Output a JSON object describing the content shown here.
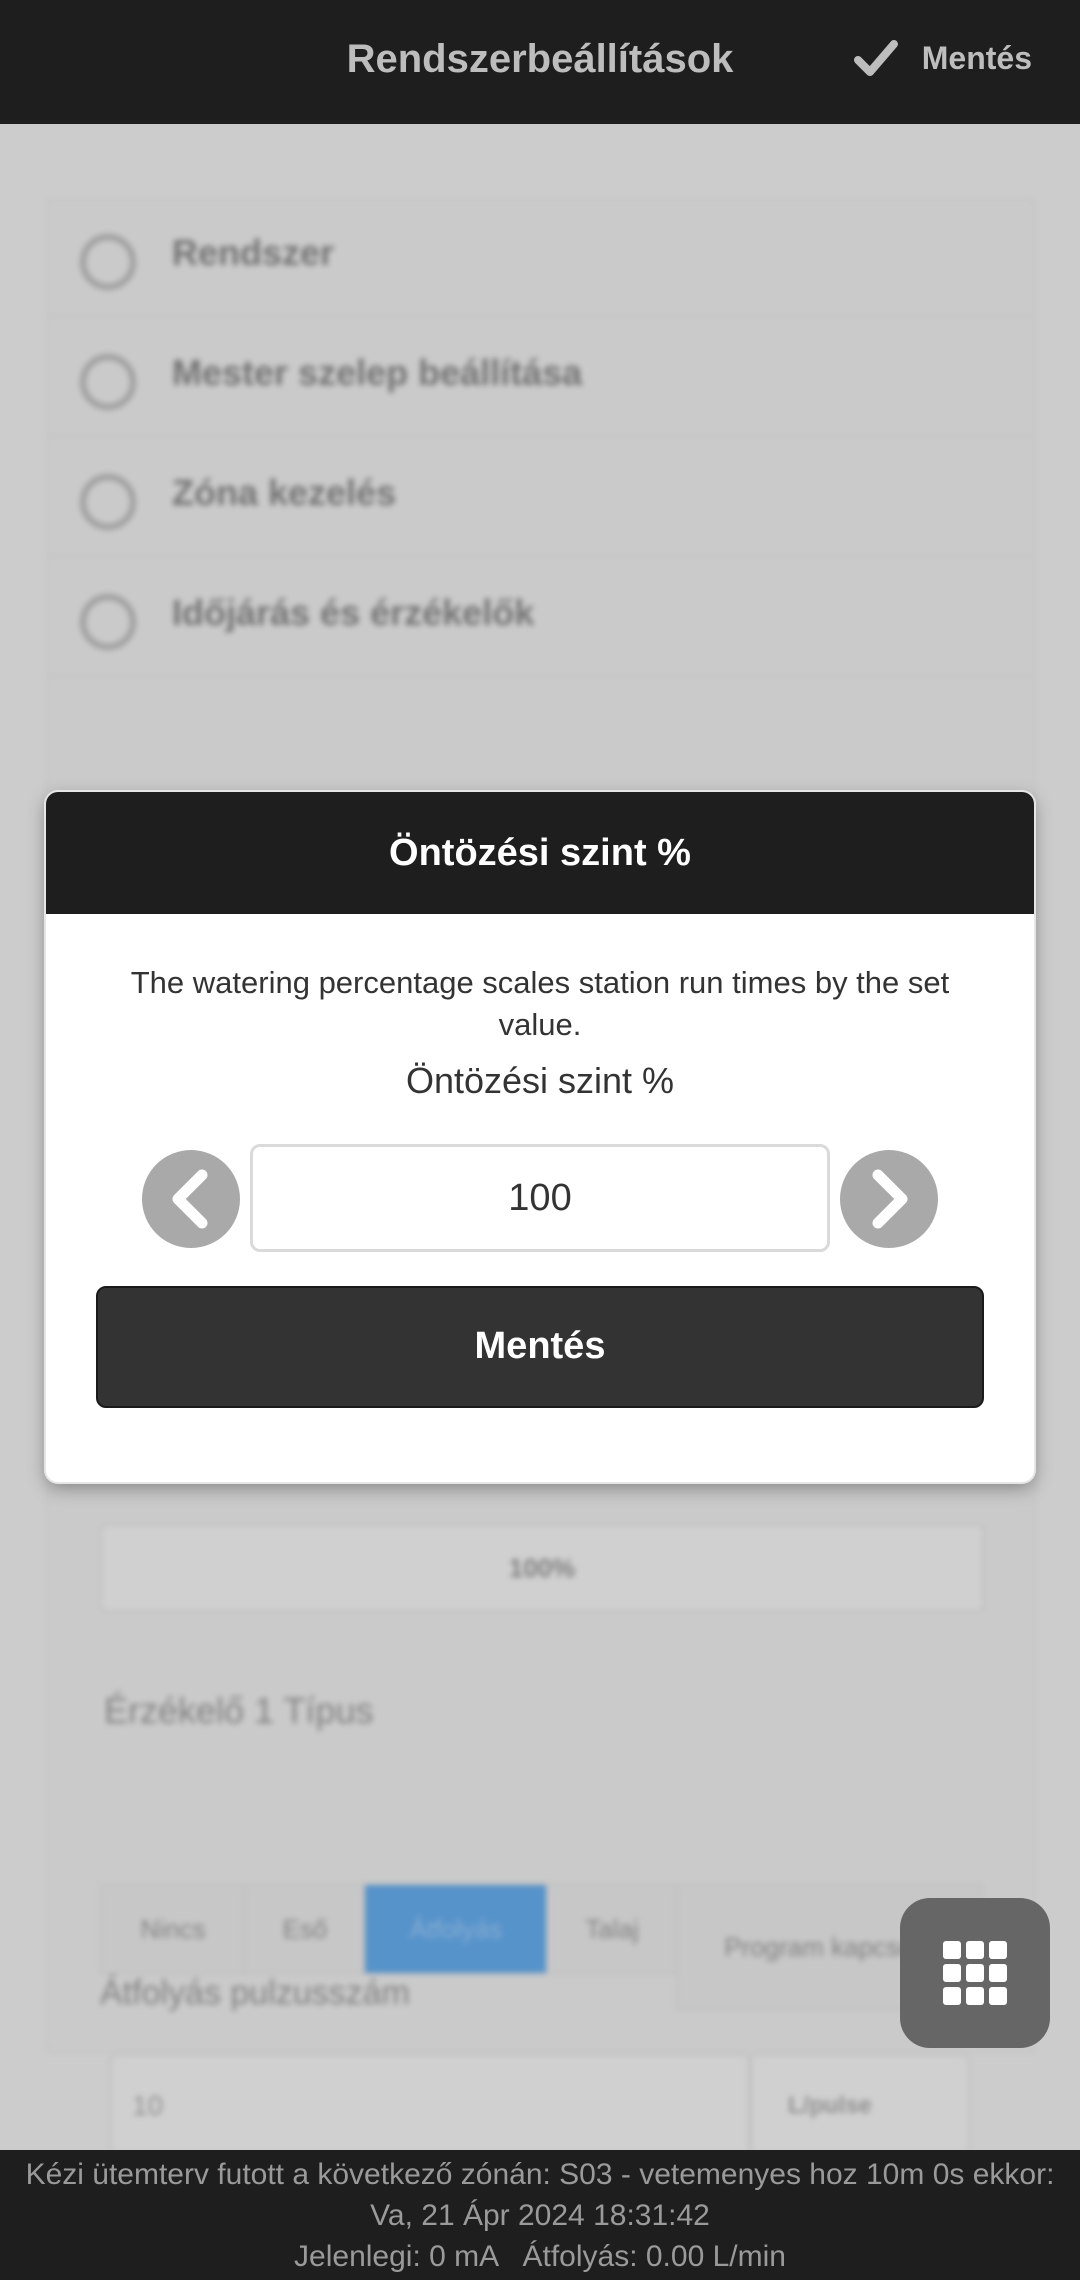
{
  "header": {
    "title": "Rendszerbeállítások",
    "save_label": "Mentés"
  },
  "background": {
    "sections": [
      {
        "label": "Rendszer",
        "icon": "plus-circle-icon"
      },
      {
        "label": "Mester szelep beállítása",
        "icon": "plus-circle-icon"
      },
      {
        "label": "Zóna kezelés",
        "icon": "plus-circle-icon"
      },
      {
        "label": "Időjárás és érzékelők",
        "icon": "minus-circle-icon"
      }
    ],
    "percent_value": "100%",
    "sensor_type_label": "Érzékelő 1 Típus",
    "sensor_types": [
      "Nincs",
      "Eső",
      "Átfolyás",
      "Talaj",
      "Program kapcsoló"
    ],
    "sensor_type_selected": "Átfolyás",
    "pulse_label": "Átfolyás pulzusszám",
    "pulse_value": "10",
    "pulse_unit": "L/pulse"
  },
  "modal": {
    "title": "Öntözési szint %",
    "description": "The watering percentage scales station run times by the set value.",
    "field_label": "Öntözési szint %",
    "value": "100",
    "save_label": "Mentés"
  },
  "footer": {
    "line1": "Kézi ütemterv futott a következő zónán: S03 - vetemenyes hoz 10m 0s ekkor:",
    "line2": "Va, 21 Ápr 2024 18:31:42",
    "line3": "Jelenlegi: 0 mA   Átfolyás: 0.00 L/min"
  },
  "colors": {
    "bar": "#1e1e1e",
    "accent": "#5b9bd5",
    "button": "#333333"
  }
}
